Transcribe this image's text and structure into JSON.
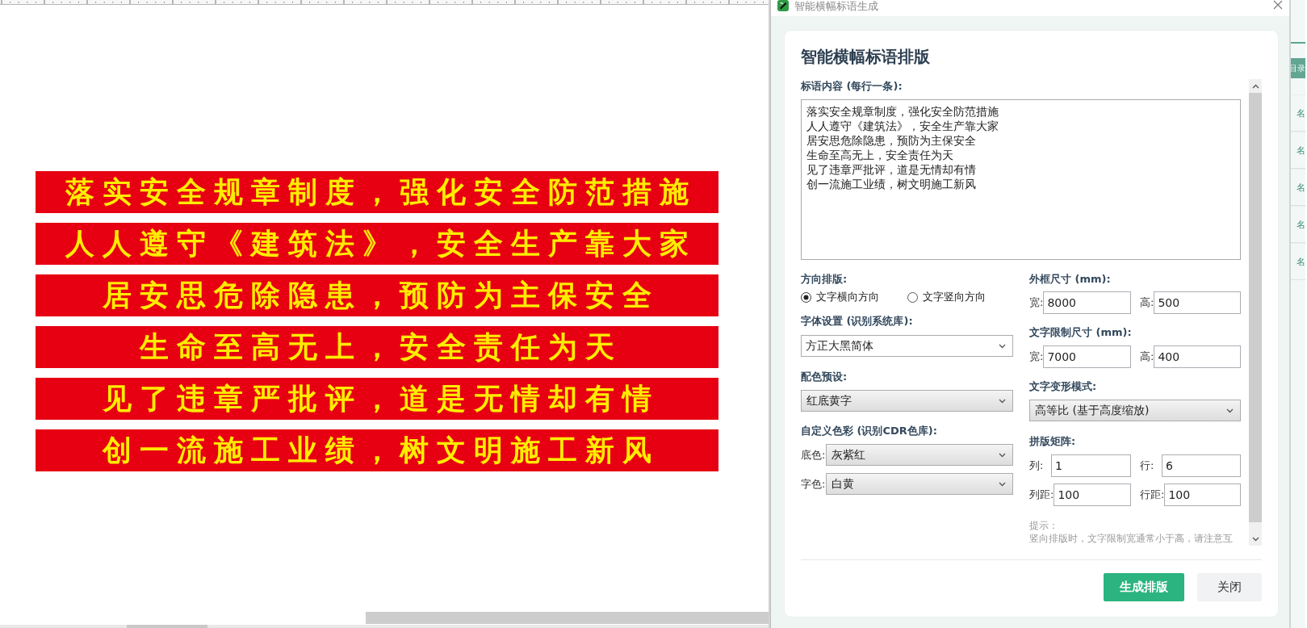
{
  "canvas": {
    "banners": [
      "落实安全规章制度，强化安全防范措施",
      "人人遵守《建筑法》，安全生产靠大家",
      "居安思危除隐患，预防为主保安全",
      "生命至高无上，安全责任为天",
      "见了违章严批评，道是无情却有情",
      "创一流施工业绩，树文明施工新风"
    ]
  },
  "dialog": {
    "title": "智能横幅标语生成",
    "heading": "智能横幅标语排版",
    "content": {
      "label": "标语内容 (每行一条):",
      "lines": [
        "落实安全规章制度，强化安全防范措施",
        "人人遵守《建筑法》，安全生产靠大家",
        "居安思危除隐患，预防为主保安全",
        "生命至高无上，安全责任为天",
        "见了违章严批评，道是无情却有情",
        "创一流施工业绩，树文明施工新风"
      ]
    },
    "direction": {
      "label": "方向排版:",
      "options": [
        {
          "label": "文字横向方向",
          "selected": true
        },
        {
          "label": "文字竖向方向",
          "selected": false
        }
      ]
    },
    "font": {
      "label": "字体设置 (识别系统库):",
      "value": "方正大黑简体",
      "editable": true
    },
    "color_preset": {
      "label": "配色预设:",
      "value": "红底黄字",
      "editable": false
    },
    "custom_color": {
      "label": "自定义色彩 (识别CDR色库):",
      "rows": [
        {
          "label": "底色:",
          "value": "灰紫红",
          "editable": false
        },
        {
          "label": "字色:",
          "value": "白黄",
          "editable": false
        }
      ]
    },
    "frame_size": {
      "label": "外框尺寸 (mm):",
      "fields": [
        {
          "label": "宽:",
          "value": "8000"
        },
        {
          "label": "高:",
          "value": "500"
        }
      ]
    },
    "text_size": {
      "label": "文字限制尺寸 (mm):",
      "fields": [
        {
          "label": "宽:",
          "value": "7000"
        },
        {
          "label": "高:",
          "value": "400"
        }
      ]
    },
    "transform_mode": {
      "label": "文字变形模式:",
      "value": "高等比 (基于高度缩放)",
      "editable": false
    },
    "matrix": {
      "label": "拼版矩阵:",
      "fields": [
        {
          "label": "列:",
          "value": "1"
        },
        {
          "label": "行:",
          "value": "6"
        },
        {
          "label": "列距:",
          "value": "100"
        },
        {
          "label": "行距:",
          "value": "100"
        }
      ]
    },
    "hint": {
      "title": "提示：",
      "text": "竖向排版时，文字限制宽通常小于高，请注意互"
    },
    "buttons": [
      {
        "label": "生成排版",
        "primary": true
      },
      {
        "label": "关闭",
        "primary": false
      }
    ]
  },
  "side_panel": {
    "tab": "目录",
    "items": [
      "名",
      "名",
      "名",
      "名",
      "名"
    ]
  }
}
